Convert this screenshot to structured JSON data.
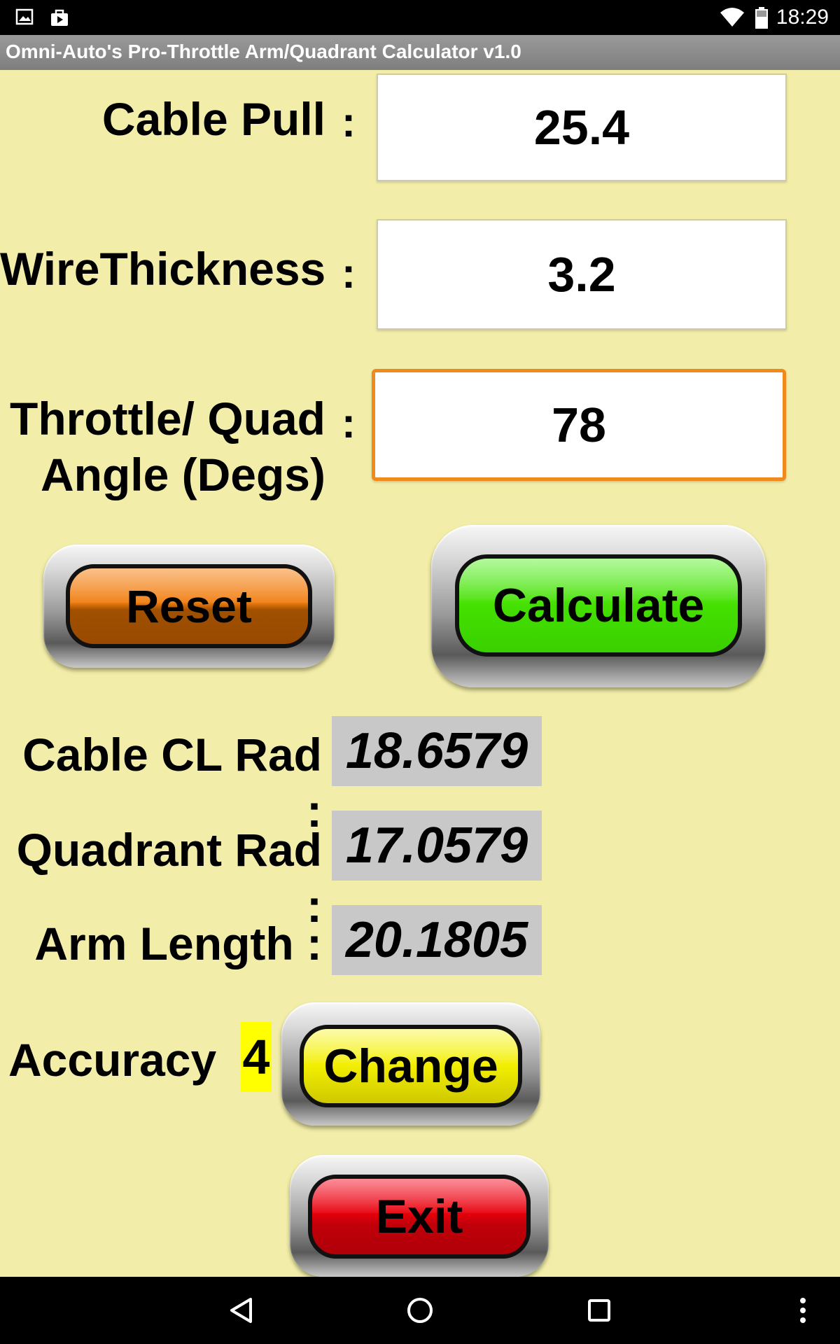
{
  "status_bar": {
    "time": "18:29",
    "icons": [
      "image-icon",
      "shopping-bag-icon",
      "wifi-icon",
      "battery-icon"
    ]
  },
  "title_bar": {
    "title": "Omni-Auto's Pro-Throttle Arm/Quadrant Calculator v1.0"
  },
  "inputs": {
    "cable_pull": {
      "label": "Cable Pull",
      "value": "25.4"
    },
    "wire_thickness": {
      "label": "WireThickness",
      "value": "3.2"
    },
    "throttle_angle": {
      "label_line1": "Throttle/ Quad",
      "label_line2": "Angle (Degs)",
      "value": "78"
    },
    "colon": ":"
  },
  "buttons": {
    "reset": "Reset",
    "calculate": "Calculate",
    "change": "Change",
    "exit": "Exit"
  },
  "results": {
    "cable_cl_rad": {
      "label": "Cable CL Rad :",
      "value": "18.6579"
    },
    "quadrant_rad": {
      "label": "Quadrant Rad :",
      "value": "17.0579"
    },
    "arm_length": {
      "label": "Arm Length :",
      "value": "20.1805"
    }
  },
  "accuracy": {
    "label": "Accuracy",
    "value": "4"
  },
  "colors": {
    "background": "#f2eda8",
    "reset": "#f07d10",
    "calculate": "#44e000",
    "change": "#f2ee00",
    "exit": "#e8000b",
    "focus_border": "#f08a1c",
    "accuracy_highlight": "#ffff00"
  },
  "nav_bar": {
    "icons": [
      "back-icon",
      "home-icon",
      "recents-icon",
      "overflow-menu-icon"
    ]
  }
}
